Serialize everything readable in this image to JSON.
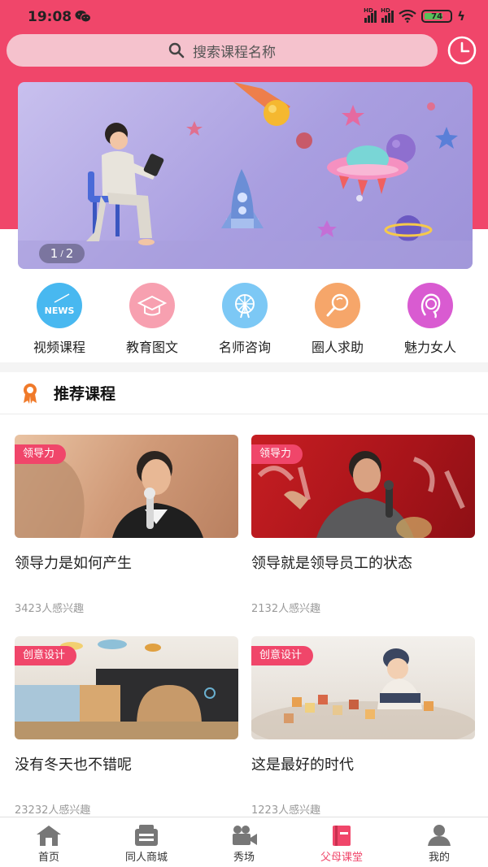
{
  "status_bar": {
    "time": "19:08",
    "battery": "74",
    "signal_tag": "HD"
  },
  "search": {
    "placeholder": "搜索课程名称"
  },
  "banner": {
    "index": "1",
    "total": "2"
  },
  "categories": [
    {
      "label": "视频课程",
      "icon": "news-icon",
      "color": "#48b8f0",
      "icon_text": "NEWS"
    },
    {
      "label": "教育图文",
      "icon": "graduation-cap-icon",
      "color": "#f7a0b0"
    },
    {
      "label": "名师咨询",
      "icon": "ferris-wheel-icon",
      "color": "#7cc8f5"
    },
    {
      "label": "圈人求助",
      "icon": "magnifier-icon",
      "color": "#f6a66a"
    },
    {
      "label": "魅力女人",
      "icon": "woman-icon",
      "color": "#d95bd1"
    }
  ],
  "section": {
    "title": "推荐课程"
  },
  "courses": [
    {
      "tag": "领导力",
      "title": "领导力是如何产生",
      "count": "3423人感兴趣"
    },
    {
      "tag": "领导力",
      "title": "领导就是领导员工的状态",
      "count": "2132人感兴趣"
    },
    {
      "tag": "创意设计",
      "title": "没有冬天也不错呢",
      "count": "23232人感兴趣"
    },
    {
      "tag": "创意设计",
      "title": "这是最好的时代",
      "count": "1223人感兴趣"
    }
  ],
  "tabbar": [
    {
      "label": "首页",
      "icon": "home-icon"
    },
    {
      "label": "同人商城",
      "icon": "store-icon"
    },
    {
      "label": "秀场",
      "icon": "video-camera-icon"
    },
    {
      "label": "父母课堂",
      "icon": "book-icon",
      "active": true
    },
    {
      "label": "我的",
      "icon": "user-icon"
    }
  ],
  "colors": {
    "accent": "#f0466a",
    "search_bg": "#f5c2cd",
    "muted_text": "#9a9a9a"
  }
}
